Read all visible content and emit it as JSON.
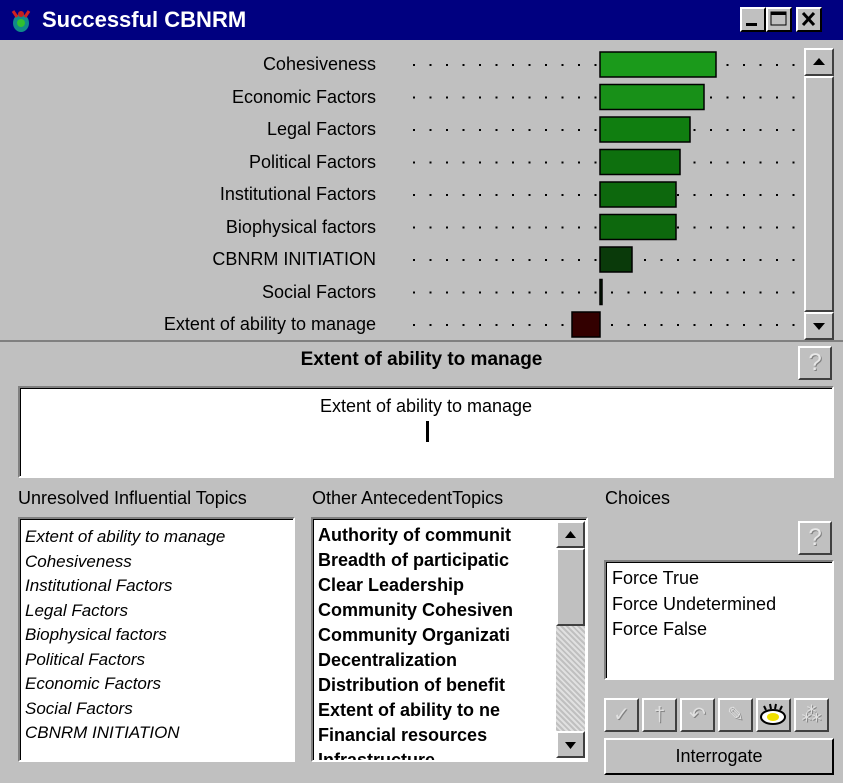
{
  "window": {
    "title": "Successful CBNRM",
    "minimize_icon": "minimize-icon",
    "maximize_icon": "maximize-icon",
    "close_icon": "close-icon"
  },
  "chart_data": {
    "type": "bar",
    "categories": [
      "Cohesiveness",
      "Economic Factors",
      "Legal Factors",
      "Political Factors",
      "Institutional Factors",
      "Biophysical factors",
      "CBNRM INITIATION",
      "Social Factors",
      "Extent of ability to manage"
    ],
    "values": [
      0.58,
      0.52,
      0.45,
      0.4,
      0.38,
      0.38,
      0.16,
      0.0,
      -0.14
    ],
    "colors": [
      "#1b9a1b",
      "#189018",
      "#107e10",
      "#0e700e",
      "#0d680d",
      "#0d680d",
      "#0a3a0a",
      "#003300",
      "#330000"
    ],
    "xlim": [
      -1,
      1
    ]
  },
  "topic": {
    "title": "Extent of ability to manage",
    "detail_text": "Extent of ability to manage"
  },
  "unresolved": {
    "label": "Unresolved Influential Topics",
    "items": [
      "Extent of ability to manage",
      "Cohesiveness",
      "Institutional Factors",
      "Legal Factors",
      "Biophysical factors",
      "Political Factors",
      "Economic Factors",
      "Social Factors",
      "CBNRM INITIATION"
    ]
  },
  "antecedent": {
    "label": "Other AntecedentTopics",
    "items": [
      "Authority of communit",
      "Breadth of participatic",
      "Clear Leadership",
      "Community Cohesiven",
      "Community Organizati",
      "Decentralization",
      "Distribution of benefit",
      "Extent of ability to ne",
      "Financial resources",
      "Infrastructure"
    ]
  },
  "choices": {
    "label": "Choices",
    "items": [
      "Force True",
      "Force Undetermined",
      "Force False"
    ],
    "interrogate_label": "Interrogate",
    "help_glyph": "?"
  },
  "toolbar": {
    "icons": [
      "checkmark-icon",
      "dagger-check-icon",
      "undo-icon",
      "pencil-icon",
      "eye-icon",
      "network-icon"
    ]
  }
}
